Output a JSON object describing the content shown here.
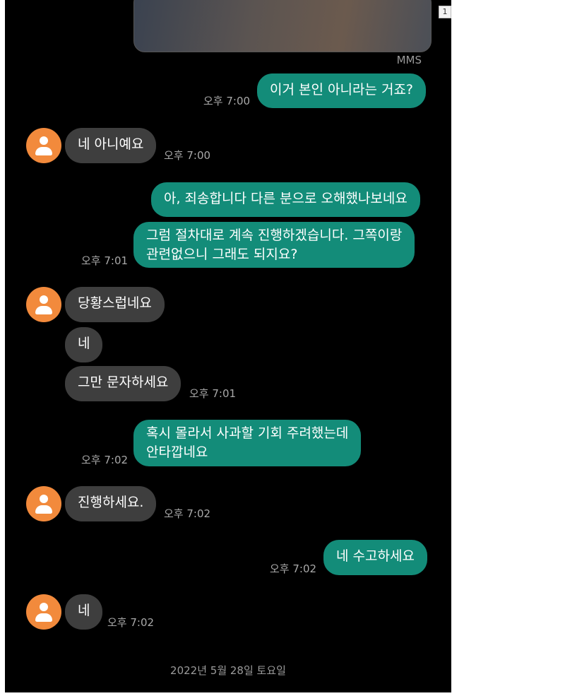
{
  "page_marker": "1",
  "attachment_label": "MMS",
  "messages": [
    {
      "side": "sent",
      "text": "이거 본인 아니라는 거죠?",
      "time": "오후 7:00"
    },
    {
      "side": "recv",
      "text": "네 아니예요",
      "time": "오후 7:00"
    },
    {
      "side": "sent",
      "text": "아, 죄송합니다 다른 분으로 오해했나보네요"
    },
    {
      "side": "sent",
      "lines": [
        "그럼 절차대로 계속 진행하겠습니다. 그쪽이랑",
        "관련없으니 그래도 되지요?"
      ],
      "time": "오후 7:01"
    },
    {
      "side": "recv",
      "text": "당황스럽네요"
    },
    {
      "side": "recv",
      "text": "네"
    },
    {
      "side": "recv",
      "text": "그만 문자하세요",
      "time": "오후 7:01"
    },
    {
      "side": "sent",
      "lines": [
        "혹시 몰라서 사과할 기회 주려했는데",
        "안타깝네요"
      ],
      "time": "오후 7:02"
    },
    {
      "side": "recv",
      "text": "진행하세요.",
      "time": "오후 7:02"
    },
    {
      "side": "sent",
      "text": "네 수고하세요",
      "time": "오후 7:02"
    },
    {
      "side": "recv",
      "text": "네",
      "time": "오후 7:02"
    }
  ],
  "footer_date": "2022년 5월 28일 토요일",
  "colors": {
    "background": "#000000",
    "sent_bubble": "#138c79",
    "received_bubble": "#3e3e3e",
    "avatar": "#f28a3c",
    "timestamp": "#a9a9a9"
  },
  "icons": {
    "avatar": "person-avatar-icon"
  }
}
